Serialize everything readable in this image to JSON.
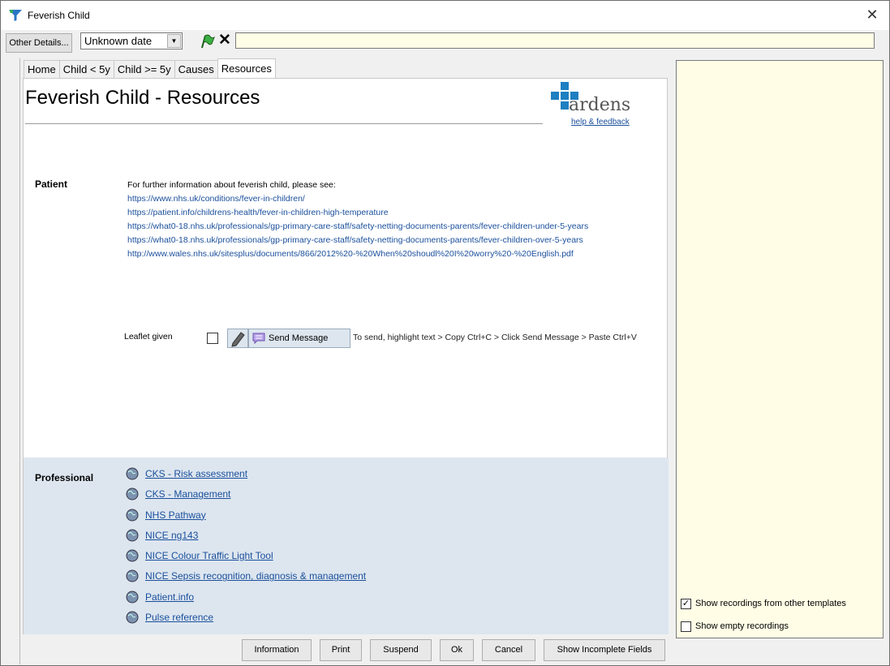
{
  "window": {
    "title": "Feverish Child",
    "close_glyph": "✕"
  },
  "toolbar": {
    "other_details_label": "Other Details...",
    "date_value": "Unknown date",
    "clear_glyph": "✕",
    "note_value": ""
  },
  "tabs": [
    {
      "label": "Home"
    },
    {
      "label": "Child < 5y"
    },
    {
      "label": "Child >= 5y"
    },
    {
      "label": "Causes"
    },
    {
      "label": "Resources",
      "active": true
    }
  ],
  "page": {
    "title": "Feverish Child - Resources",
    "logo_text": "ardens",
    "help_link": "help & feedback"
  },
  "patient": {
    "label": "Patient",
    "intro": "For further information about feverish child, please see:",
    "links": [
      "https://www.nhs.uk/conditions/fever-in-children/",
      "https://patient.info/childrens-health/fever-in-children-high-temperature",
      "https://what0-18.nhs.uk/professionals/gp-primary-care-staff/safety-netting-documents-parents/fever-children-under-5-years",
      "https://what0-18.nhs.uk/professionals/gp-primary-care-staff/safety-netting-documents-parents/fever-children-over-5-years",
      "http://www.wales.nhs.uk/sitesplus/documents/866/2012%20-%20When%20shoudl%20I%20worry%20-%20English.pdf"
    ]
  },
  "leaflet": {
    "label": "Leaflet given",
    "checked": false,
    "send_label": "Send Message",
    "hint": "To send, highlight text > Copy Ctrl+C > Click Send Message > Paste Ctrl+V"
  },
  "professional": {
    "label": "Professional",
    "links": [
      "CKS - Risk assessment",
      "CKS - Management",
      "NHS Pathway",
      "NICE ng143",
      "NICE Colour Traffic Light Tool",
      "NICE Sepsis recognition, diagnosis & management",
      "Patient.info",
      "Pulse reference"
    ]
  },
  "buttons": {
    "information": "Information",
    "print": "Print",
    "suspend": "Suspend",
    "ok": "Ok",
    "cancel": "Cancel",
    "show_incomplete": "Show Incomplete Fields"
  },
  "side": {
    "show_other_templates": "Show recordings from other templates",
    "show_other_templates_checked": true,
    "show_empty": "Show empty recordings",
    "show_empty_checked": false
  },
  "colors": {
    "link": "#1a4f9c",
    "side_bg": "#fffde6",
    "prof_bg": "#dde6ef",
    "logo_blue": "#1e7fc1"
  }
}
